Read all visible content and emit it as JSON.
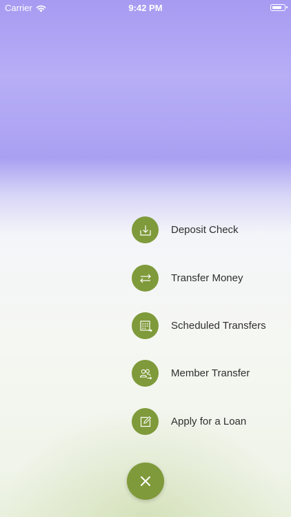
{
  "status_bar": {
    "carrier": "Carrier",
    "time": "9:42 PM"
  },
  "colors": {
    "accent": "#7f9a3a",
    "header_gradient_top": "#a79af2",
    "label_text": "#2f2f2f"
  },
  "menu": {
    "items": [
      {
        "label": "Deposit Check",
        "icon": "deposit-check-icon"
      },
      {
        "label": "Transfer Money",
        "icon": "transfer-arrows-icon"
      },
      {
        "label": "Scheduled Transfers",
        "icon": "calendar-schedule-icon"
      },
      {
        "label": "Member Transfer",
        "icon": "member-transfer-icon"
      },
      {
        "label": "Apply for a Loan",
        "icon": "apply-loan-icon"
      }
    ],
    "close_icon": "close-icon"
  }
}
